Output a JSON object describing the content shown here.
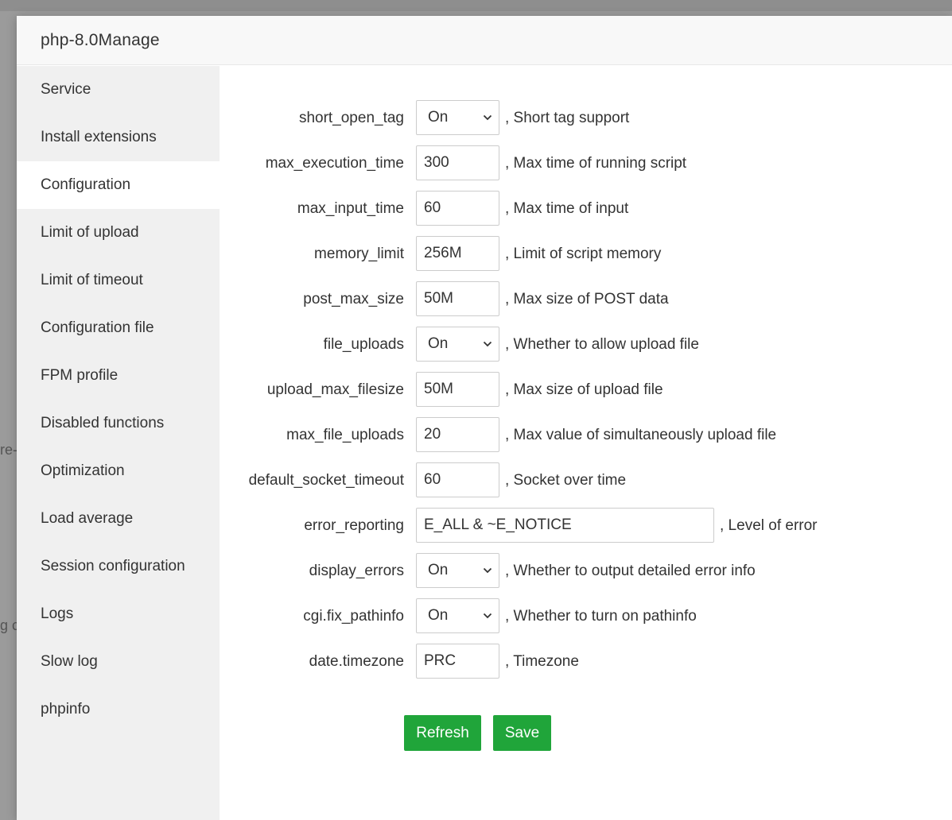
{
  "modal": {
    "title": "php-8.0Manage"
  },
  "background": {
    "left_text_1": "re-",
    "left_text_2": "g c"
  },
  "sidebar": {
    "items": [
      {
        "label": "Service",
        "name": "sidebar-item-service"
      },
      {
        "label": "Install extensions",
        "name": "sidebar-item-install-extensions"
      },
      {
        "label": "Configuration",
        "name": "sidebar-item-configuration",
        "active": true
      },
      {
        "label": "Limit of upload",
        "name": "sidebar-item-limit-of-upload"
      },
      {
        "label": "Limit of timeout",
        "name": "sidebar-item-limit-of-timeout"
      },
      {
        "label": "Configuration file",
        "name": "sidebar-item-configuration-file"
      },
      {
        "label": "FPM profile",
        "name": "sidebar-item-fpm-profile"
      },
      {
        "label": "Disabled functions",
        "name": "sidebar-item-disabled-functions"
      },
      {
        "label": "Optimization",
        "name": "sidebar-item-optimization"
      },
      {
        "label": "Load average",
        "name": "sidebar-item-load-average"
      },
      {
        "label": "Session configuration",
        "name": "sidebar-item-session-configuration"
      },
      {
        "label": "Logs",
        "name": "sidebar-item-logs"
      },
      {
        "label": "Slow log",
        "name": "sidebar-item-slow-log"
      },
      {
        "label": "phpinfo",
        "name": "sidebar-item-phpinfo"
      }
    ]
  },
  "config": {
    "rows": [
      {
        "key": "short_open_tag",
        "type": "select",
        "value": "On",
        "desc": ", Short tag support"
      },
      {
        "key": "max_execution_time",
        "type": "input",
        "value": "300",
        "desc": ", Max time of running script"
      },
      {
        "key": "max_input_time",
        "type": "input",
        "value": "60",
        "desc": ", Max time of input"
      },
      {
        "key": "memory_limit",
        "type": "input",
        "value": "256M",
        "desc": ", Limit of script memory"
      },
      {
        "key": "post_max_size",
        "type": "input",
        "value": "50M",
        "desc": ", Max size of POST data"
      },
      {
        "key": "file_uploads",
        "type": "select",
        "value": "On",
        "desc": ", Whether to allow upload file"
      },
      {
        "key": "upload_max_filesize",
        "type": "input",
        "value": "50M",
        "desc": ", Max size of upload file"
      },
      {
        "key": "max_file_uploads",
        "type": "input",
        "value": "20",
        "desc": ", Max value of simultaneously upload file"
      },
      {
        "key": "default_socket_timeout",
        "type": "input",
        "value": "60",
        "desc": ", Socket over time"
      },
      {
        "key": "error_reporting",
        "type": "input-wide",
        "value": "E_ALL & ~E_NOTICE",
        "desc": ", Level of error"
      },
      {
        "key": "display_errors",
        "type": "select",
        "value": "On",
        "desc": ", Whether to output detailed error info"
      },
      {
        "key": "cgi.fix_pathinfo",
        "type": "select",
        "value": "On",
        "desc": ", Whether to turn on pathinfo"
      },
      {
        "key": "date.timezone",
        "type": "input",
        "value": "PRC",
        "desc": ", Timezone"
      }
    ]
  },
  "buttons": {
    "refresh_label": "Refresh",
    "save_label": "Save"
  },
  "colors": {
    "primary_green": "#20a53a",
    "sidebar_bg": "#f0f0f0",
    "header_bg": "#f8f8f8"
  },
  "icons": {
    "select_arrow": "chevron-down-icon"
  }
}
